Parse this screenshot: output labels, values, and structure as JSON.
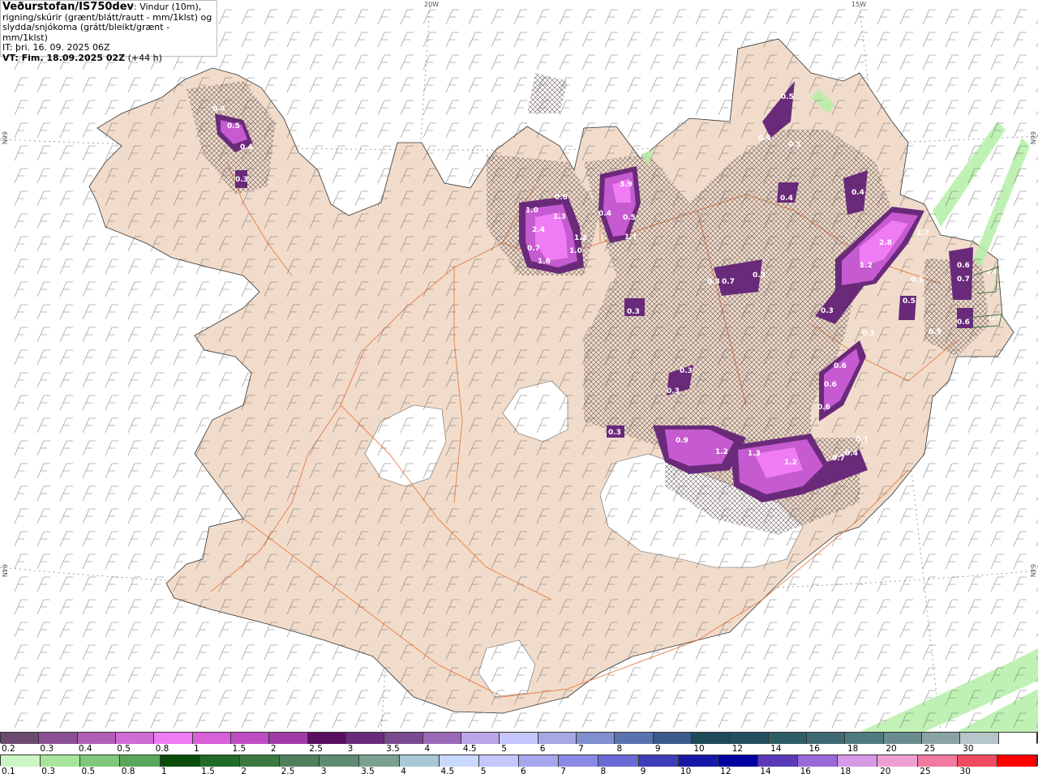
{
  "header": {
    "title_bold": "Veðurstofan/IS750dev",
    "title_rest": ": Vindur (10m),",
    "line2": "rigning/skúrir (grænt/blátt/rautt - mm/1klst) og",
    "line3": "slydda/snjókoma (grátt/bleikt/grænt - mm/1klst)",
    "it": "IT: þri. 16. 09. 2025 06Z",
    "vt_bold": "VT: Fim. 18.09.2025 02Z",
    "vt_rest": " (+44 h)"
  },
  "grid_labels": {
    "lon_20w": "20W",
    "lon_15w": "15W",
    "lat_66n_left": "66N",
    "lat_66n_right": "66N",
    "lat_64n_left": "64N",
    "lat_64n_right": "64N"
  },
  "precip_labels": [
    {
      "text": "0.4"
    },
    {
      "text": "0.5"
    },
    {
      "text": "0.4"
    },
    {
      "text": "0.3"
    },
    {
      "text": "1.0"
    },
    {
      "text": "0.6"
    },
    {
      "text": "1.3"
    },
    {
      "text": "2.4"
    },
    {
      "text": "1.2"
    },
    {
      "text": "0.7"
    },
    {
      "text": "1.0"
    },
    {
      "text": "1.6"
    },
    {
      "text": "3.9"
    },
    {
      "text": "0.4"
    },
    {
      "text": "0.5"
    },
    {
      "text": "1.1"
    },
    {
      "text": "0.5"
    },
    {
      "text": "0.4"
    },
    {
      "text": "0.5"
    },
    {
      "text": "0.4"
    },
    {
      "text": "0.4"
    },
    {
      "text": "0.3"
    },
    {
      "text": "0.7"
    },
    {
      "text": "0.3"
    },
    {
      "text": "0.3"
    },
    {
      "text": "2.7"
    },
    {
      "text": "2.8"
    },
    {
      "text": "1.2"
    },
    {
      "text": "0.3"
    },
    {
      "text": "0.3"
    },
    {
      "text": "0.6"
    },
    {
      "text": "0.6"
    },
    {
      "text": "0.6"
    },
    {
      "text": "0.3"
    },
    {
      "text": "0.3"
    },
    {
      "text": "0.3"
    },
    {
      "text": "0.9"
    },
    {
      "text": "1.2"
    },
    {
      "text": "1.3"
    },
    {
      "text": "1.2"
    },
    {
      "text": "0.7"
    },
    {
      "text": "0.4"
    },
    {
      "text": "0.1"
    },
    {
      "text": "0.6"
    },
    {
      "text": "0.7"
    },
    {
      "text": "0.1"
    },
    {
      "text": "0.5"
    },
    {
      "text": "0.5"
    },
    {
      "text": "0.6"
    },
    {
      "text": "0.6"
    },
    {
      "text": "0.3"
    }
  ],
  "legend_snow": {
    "ticks": [
      "0.2",
      "0.3",
      "0.4",
      "0.5",
      "0.8",
      "1",
      "1.5",
      "2",
      "2.5",
      "3",
      "3.5",
      "4",
      "4.5",
      "5",
      "6",
      "7",
      "8",
      "9",
      "10",
      "12",
      "14",
      "16",
      "18",
      "20",
      "25",
      "30"
    ],
    "colors": [
      "#6d4a70",
      "#8c4f93",
      "#b05fb8",
      "#cf6cd6",
      "#f07cf5",
      "#d860d8",
      "#c04cc4",
      "#a03aa8",
      "#5a0f5e",
      "#6a2a7a",
      "#7a4a90",
      "#9a6ab8",
      "#b9a6e6",
      "#c6c6ff",
      "#a7a7e6",
      "#7f8fd0",
      "#5a72b0",
      "#3d5a8c",
      "#1f4a5a",
      "#244e5e",
      "#2f5d66",
      "#3d6a72",
      "#4f7a7e",
      "#6a8c8e",
      "#8aa4a6",
      "#b5c6c8",
      "#ffffff"
    ]
  },
  "legend_rain": {
    "ticks": [
      "0.1",
      "0.3",
      "0.5",
      "0.8",
      "1",
      "1.5",
      "2",
      "2.5",
      "3",
      "3.5",
      "4",
      "4.5",
      "5",
      "6",
      "7",
      "8",
      "9",
      "10",
      "12",
      "14",
      "16",
      "18",
      "20",
      "25",
      "30"
    ],
    "colors": [
      "#ccf5c4",
      "#a6e59a",
      "#7fc87a",
      "#5aa65a",
      "#0a4d0a",
      "#206a2a",
      "#3a7a40",
      "#4f7f5a",
      "#5f8a72",
      "#7aa090",
      "#a8c8d8",
      "#c8d8ff",
      "#c6c6ff",
      "#a7a7f0",
      "#8a8ae6",
      "#6a6ad6",
      "#3d3db8",
      "#1818a8",
      "#0000a0",
      "#5a3ab8",
      "#9a6ad8",
      "#d69ae6",
      "#f0a0d0",
      "#f07aa0",
      "#f04a60",
      "#ff0000"
    ]
  }
}
